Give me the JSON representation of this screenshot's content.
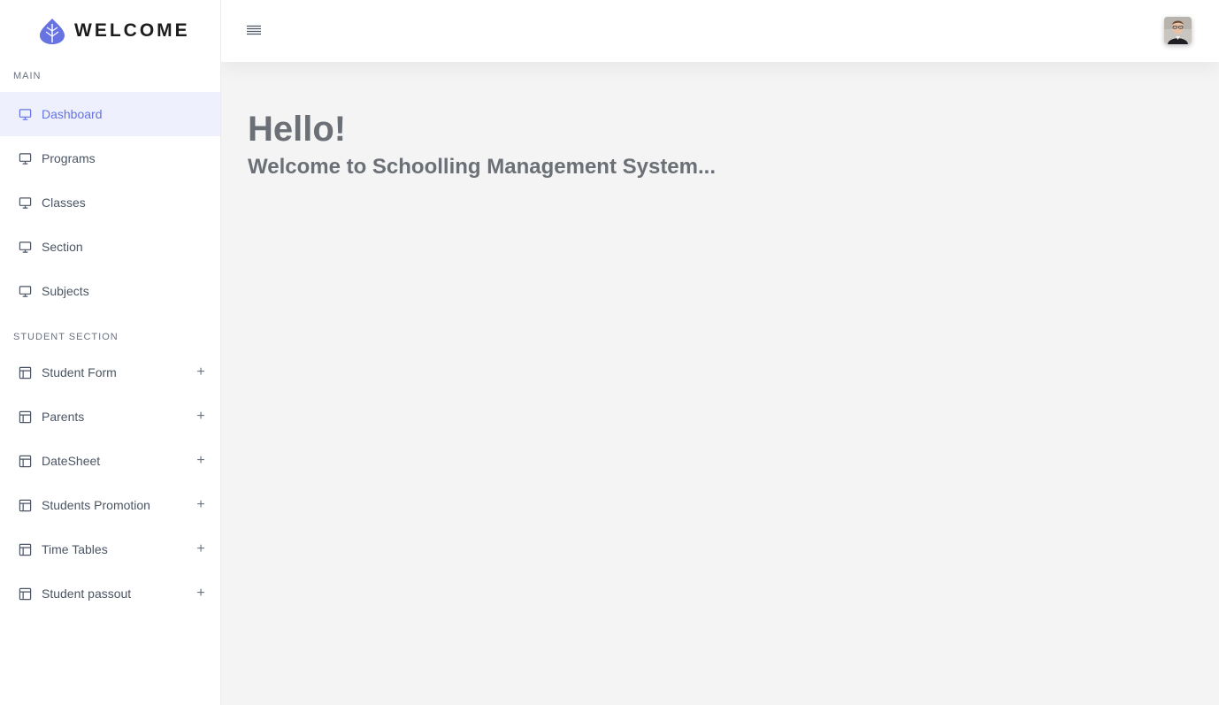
{
  "brand": {
    "name": "WELCOME",
    "logo_icon": "leaf-icon",
    "accent": "#6673e0"
  },
  "sidebar": {
    "main_label": "MAIN",
    "main_items": [
      {
        "label": "Dashboard",
        "icon": "monitor-icon",
        "active": true
      },
      {
        "label": "Programs",
        "icon": "monitor-icon"
      },
      {
        "label": "Classes",
        "icon": "monitor-icon"
      },
      {
        "label": "Section",
        "icon": "monitor-icon"
      },
      {
        "label": "Subjects",
        "icon": "monitor-icon"
      }
    ],
    "student_label": "STUDENT SECTION",
    "student_items": [
      {
        "label": "Student Form",
        "icon": "layout-icon",
        "expand": "+"
      },
      {
        "label": "Parents",
        "icon": "layout-icon",
        "expand": "+"
      },
      {
        "label": "DateSheet",
        "icon": "layout-icon",
        "expand": "+"
      },
      {
        "label": "Students Promotion",
        "icon": "layout-icon",
        "expand": "+"
      },
      {
        "label": "Time Tables",
        "icon": "layout-icon",
        "expand": "+"
      },
      {
        "label": "Student passout",
        "icon": "layout-icon",
        "expand": "+"
      }
    ]
  },
  "header": {
    "menu_icon": "hamburger-icon",
    "avatar_icon": "user-avatar"
  },
  "main": {
    "greeting": "Hello!",
    "subtitle": "Welcome to Schoolling Management System..."
  },
  "colors": {
    "active_bg": "#eef0fd",
    "text": "#4b5563",
    "heading": "#6b6f76",
    "page_bg": "#f4f4f4"
  }
}
